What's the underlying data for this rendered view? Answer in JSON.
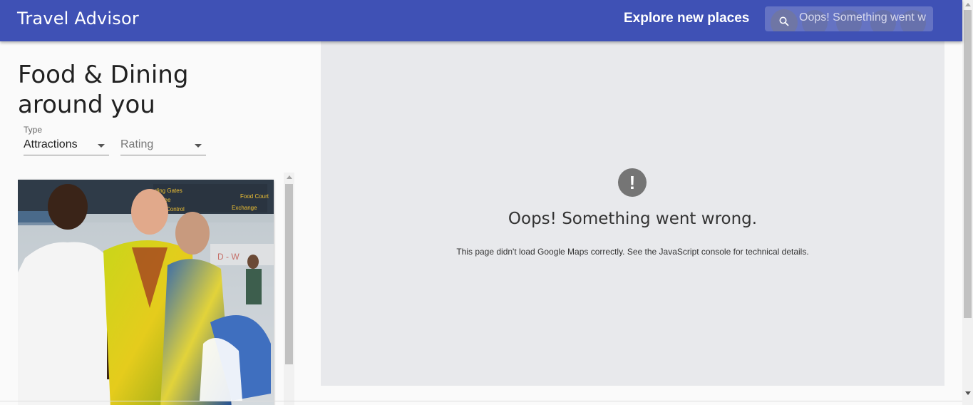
{
  "header": {
    "app_title": "Travel Advisor",
    "explore_label": "Explore new places",
    "search": {
      "value": "Oops! Something went w"
    }
  },
  "sidebar": {
    "title": "Food & Dining around you",
    "type_filter": {
      "label": "Type",
      "value": "Attractions"
    },
    "rating_filter": {
      "placeholder": "Rating"
    },
    "card": {
      "image_icon": "photo-of-people-at-airport"
    }
  },
  "map": {
    "error_icon": "exclamation-icon",
    "error_title": "Oops! Something went wrong.",
    "error_description": "This page didn't load Google Maps correctly. See the JavaScript console for technical details."
  },
  "colors": {
    "appbar": "#3f51b5",
    "map_background": "#e8e9ec"
  }
}
